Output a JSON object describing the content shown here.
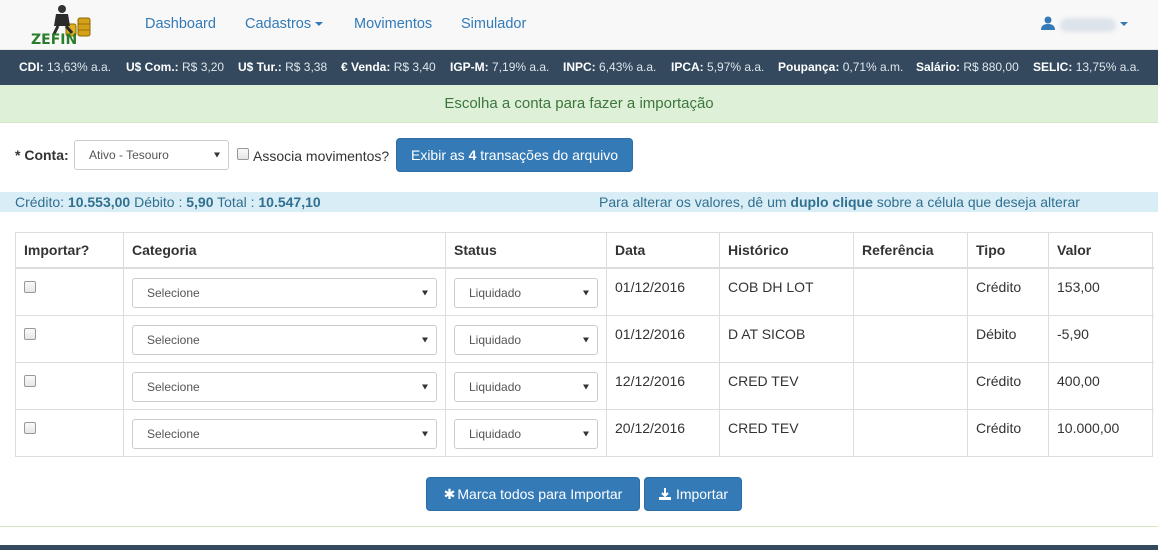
{
  "nav": {
    "items": [
      {
        "label": "Dashboard"
      },
      {
        "label": "Cadastros"
      },
      {
        "label": "Movimentos"
      },
      {
        "label": "Simulador"
      }
    ]
  },
  "logo_text": "ZEFIN",
  "indicators": [
    {
      "name": "CDI:",
      "value": "13,63% a.a."
    },
    {
      "name": "U$ Com.:",
      "value": "R$ 3,20"
    },
    {
      "name": "U$ Tur.:",
      "value": "R$ 3,38"
    },
    {
      "name": "€ Venda:",
      "value": "R$ 3,40"
    },
    {
      "name": "IGP-M:",
      "value": "7,19% a.a."
    },
    {
      "name": "INPC:",
      "value": "6,43% a.a."
    },
    {
      "name": "IPCA:",
      "value": "5,97% a.a."
    },
    {
      "name": "Poupança:",
      "value": "0,71% a.m."
    },
    {
      "name": "Salário:",
      "value": "R$ 880,00"
    },
    {
      "name": "SELIC:",
      "value": "13,75% a.a."
    }
  ],
  "alert": "Escolha a conta para fazer a importação",
  "form": {
    "conta_label": "* Conta:",
    "conta_value": "Ativo - Tesouro",
    "associa_label": "Associa movimentos?",
    "exibir_prefix": "Exibir as ",
    "exibir_count": "4",
    "exibir_suffix": " transações do arquivo"
  },
  "summary": {
    "credito_label": "Crédito: ",
    "credito_value": "10.553,00",
    "debito_label": " Débito : ",
    "debito_value": "5,90",
    "total_label": " Total : ",
    "total_value": "10.547,10",
    "hint_prefix": "Para alterar os valores, dê um ",
    "hint_bold": "duplo clique",
    "hint_suffix": " sobre a célula que deseja alterar"
  },
  "table": {
    "headers": [
      "Importar?",
      "Categoria",
      "Status",
      "Data",
      "Histórico",
      "Referência",
      "Tipo",
      "Valor"
    ],
    "rows": [
      {
        "categoria": "Selecione",
        "status": "Liquidado",
        "data": "01/12/2016",
        "historico": "COB DH LOT",
        "referencia": "",
        "tipo": "Crédito",
        "valor": "153,00"
      },
      {
        "categoria": "Selecione",
        "status": "Liquidado",
        "data": "01/12/2016",
        "historico": "D AT SICOB",
        "referencia": "",
        "tipo": "Débito",
        "valor": "-5,90"
      },
      {
        "categoria": "Selecione",
        "status": "Liquidado",
        "data": "12/12/2016",
        "historico": "CRED TEV",
        "referencia": "",
        "tipo": "Crédito",
        "valor": "400,00"
      },
      {
        "categoria": "Selecione",
        "status": "Liquidado",
        "data": "20/12/2016",
        "historico": "CRED TEV",
        "referencia": "",
        "tipo": "Crédito",
        "valor": "10.000,00"
      }
    ]
  },
  "buttons": {
    "marca_todos": "Marca todos para Importar",
    "importar": "Importar"
  }
}
